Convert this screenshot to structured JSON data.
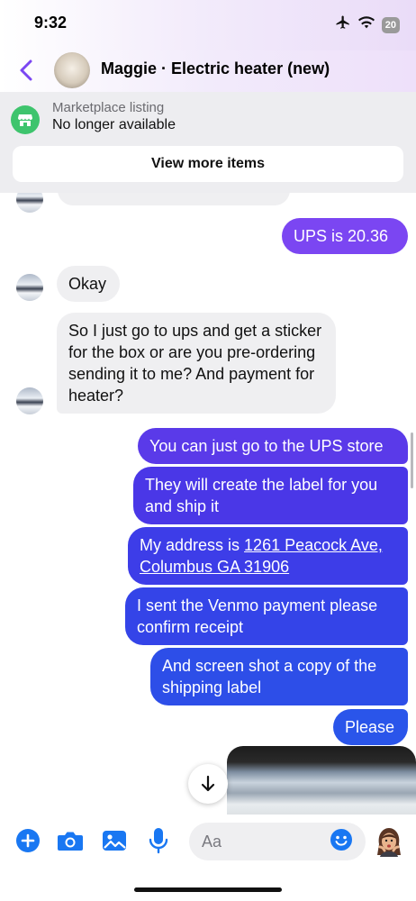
{
  "status_bar": {
    "time": "9:32",
    "battery": "20"
  },
  "header": {
    "title": "Maggie · Electric heater (new)"
  },
  "listing": {
    "label": "Marketplace listing",
    "status": "No longer available",
    "button_label": "View more items"
  },
  "messages": [
    {
      "direction": "out",
      "text": "UPS is 20.36"
    },
    {
      "direction": "in",
      "text": "Okay"
    },
    {
      "direction": "in",
      "text": "So I just go to ups and get a sticker for the box or are you pre-ordering sending it to me? And payment for heater?"
    },
    {
      "direction": "out",
      "text": "You can just go to the UPS store"
    },
    {
      "direction": "out",
      "text": "They will create the label for you and ship it"
    },
    {
      "direction": "out",
      "text_prefix": "My address is ",
      "link_text": "1261 Peacock Ave, Columbus GA 31906"
    },
    {
      "direction": "out",
      "text": "I sent the Venmo payment please confirm receipt"
    },
    {
      "direction": "out",
      "text": "And screen shot a copy of the shipping label"
    },
    {
      "direction": "out",
      "text": "Please"
    }
  ],
  "composer": {
    "placeholder": "Aa"
  },
  "colors": {
    "accent_purple": "#7b46f2",
    "bubble_violet": "#6a3ae8",
    "bubble_indigo": "#4738e6",
    "bubble_blue": "#2d4ee8",
    "icon_blue": "#1977f2",
    "incoming_bubble": "#efeff1",
    "listing_green": "#3ec46d"
  }
}
